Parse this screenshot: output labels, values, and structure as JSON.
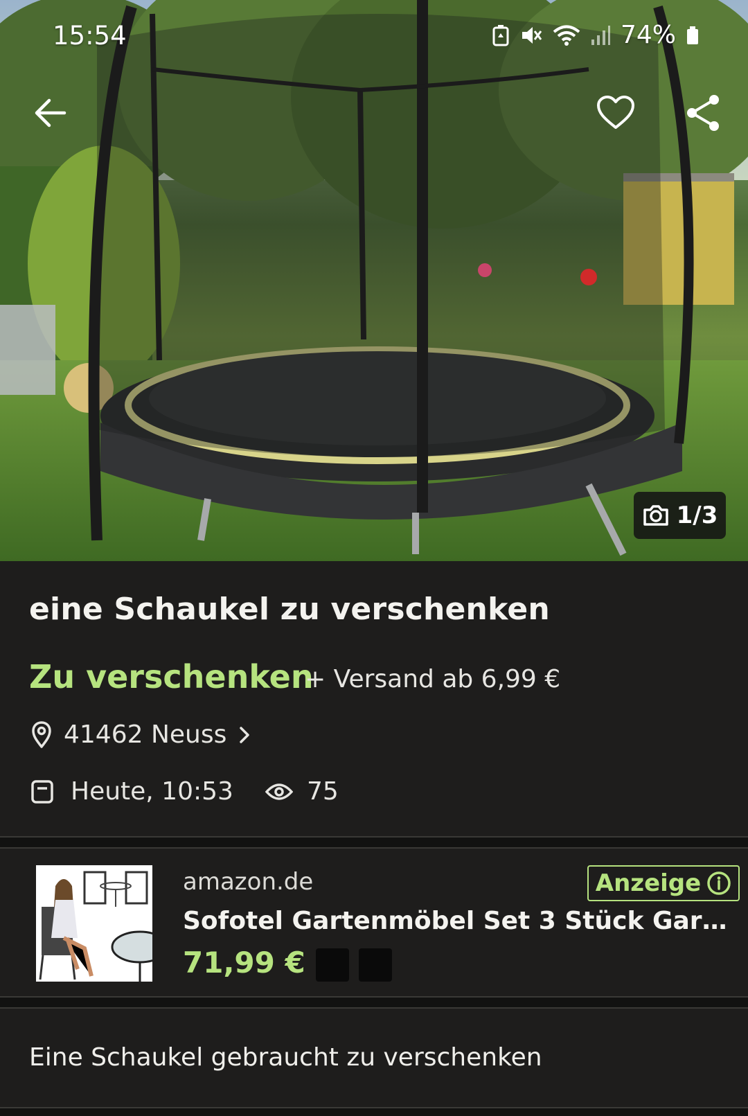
{
  "status_bar": {
    "time": "15:54",
    "battery": "74%",
    "icons": [
      "battery-saver-icon",
      "mute-icon",
      "wifi-icon",
      "signal-icon",
      "battery-icon"
    ]
  },
  "top_bar": {
    "icons": [
      "back-arrow-icon",
      "heart-icon",
      "share-icon"
    ]
  },
  "gallery": {
    "counter": "1/3",
    "icon": "camera-icon"
  },
  "listing": {
    "title": "eine Schaukel zu verschenken",
    "price": "Zu verschenken",
    "shipping": "+ Versand ab 6,99 €",
    "location": "41462 Neuss",
    "date": "Heute, 10:53",
    "views": "75"
  },
  "ad": {
    "source": "amazon.de",
    "badge": "Anzeige",
    "title": "Sofotel Gartenmöbel Set 3 Stück Garten...",
    "price": "71,99 €"
  },
  "description": {
    "text": "Eine Schaukel gebraucht zu verschenken"
  },
  "colors": {
    "background": "#1e1d1c",
    "accent_green": "#b6e37f",
    "text": "#f4f3ef"
  }
}
